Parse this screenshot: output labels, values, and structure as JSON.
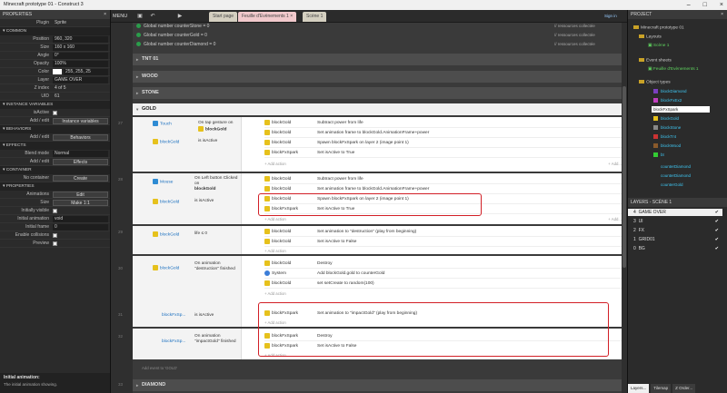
{
  "window": {
    "title": "Minecraft prototype 01 - Construct 3"
  },
  "toolbar": {
    "menu": "MENU",
    "sign_in": "Sign in"
  },
  "tabs": [
    {
      "label": "Start page",
      "active": false
    },
    {
      "label": "Feuille d'Evènements 1",
      "active": true
    },
    {
      "label": "Scène 1",
      "active": false
    }
  ],
  "properties": {
    "title": "PROPERTIES",
    "plugin_label": "Plugin",
    "plugin_value": "Sprite",
    "sections": {
      "common": "COMMON",
      "instance_vars": "INSTANCE VARIABLES",
      "behaviors": "BEHAVIORS",
      "effects": "EFFECTS",
      "container": "CONTAINER",
      "props": "PROPERTIES"
    },
    "rows": {
      "position": {
        "label": "Position",
        "value": "960, 320"
      },
      "size": {
        "label": "Size",
        "value": "160 x 160"
      },
      "angle": {
        "label": "Angle",
        "value": "0°"
      },
      "opacity": {
        "label": "Opacity",
        "value": "100%"
      },
      "color": {
        "label": "Color",
        "value": "255, 255, 25"
      },
      "layer": {
        "label": "Layer",
        "value": "GAME OVER"
      },
      "zindex": {
        "label": "Z index",
        "value": "4 of 5"
      },
      "uid": {
        "label": "UID",
        "value": "61"
      },
      "isactive": {
        "label": "isActive"
      },
      "addedit_iv": {
        "label": "Add / edit",
        "btn": "Instance variables"
      },
      "addedit_beh": {
        "label": "Add / edit",
        "btn": "Behaviors"
      },
      "blend": {
        "label": "Blend mode",
        "value": "Normal"
      },
      "addedit_fx": {
        "label": "Add / edit",
        "btn": "Effects"
      },
      "nocontainer": {
        "label": "No container",
        "btn": "Create"
      },
      "animations": {
        "label": "Animations",
        "btn": "Edit"
      },
      "sizebtn": {
        "label": "Size",
        "btn": "Make 1:1"
      },
      "initvis": {
        "label": "Initially visible"
      },
      "initanim": {
        "label": "Initial animation",
        "value": "void"
      },
      "initframe": {
        "label": "Initial frame",
        "value": "0"
      },
      "enablecol": {
        "label": "Enable collisions"
      },
      "preview": {
        "label": "Preview"
      }
    },
    "footer_title": "Initial animation:",
    "footer_desc": "The initial animation showing."
  },
  "globals": [
    {
      "text": "Global number counterStone = 0",
      "comment": "// ressources collectée"
    },
    {
      "text": "Global number counterGold = 0",
      "comment": "// ressources collectée"
    },
    {
      "text": "Global number counterDiamond = 0",
      "comment": "// ressources collectée"
    }
  ],
  "groups": {
    "tnt": "TNT 01",
    "wood": "WOOD",
    "stone": "STONE",
    "gold": "GOLD",
    "diamond": "DIAMOND"
  },
  "events": {
    "e1": {
      "num": "27",
      "c1_obj": "Touch",
      "c1_text": "On tap gesture on",
      "c1_target": "blockGold",
      "c2_obj": "blockGold",
      "c2_text": "is isActive",
      "actions": [
        {
          "obj": "blockGold",
          "text": "Subtract power from life"
        },
        {
          "obj": "blockGold",
          "text": "Set animation frame to blockGold.AnimationFrame+power"
        },
        {
          "obj": "blockGold",
          "text": "Spawn blockFxSpark on layer 2 (image point 1)"
        },
        {
          "obj": "blockFxSpark",
          "text": "Set isActive to True"
        }
      ]
    },
    "e2": {
      "num": "28",
      "c1_obj": "Mouse",
      "c1_text": "On Left button Clicked on",
      "c1_target": "blockGold",
      "c2_obj": "blockGold",
      "c2_text": "is isActive",
      "actions": [
        {
          "obj": "blockGold",
          "text": "Subtract power from life"
        },
        {
          "obj": "blockGold",
          "text": "Set animation frame to blockGold.AnimationFrame+power"
        },
        {
          "obj": "blockGold",
          "text": "Spawn blockFxSpark on layer 2 (image point 1)"
        },
        {
          "obj": "blockFxSpark",
          "text": "Set isActive to True"
        }
      ]
    },
    "e3": {
      "num": "29",
      "c1_obj": "blockGold",
      "c1_text": "life ≤ 0",
      "actions": [
        {
          "obj": "blockGold",
          "text": "Set animation to \"destruction\" (play from beginning)"
        },
        {
          "obj": "blockGold",
          "text": "Set isActive to False"
        }
      ]
    },
    "e4": {
      "num": "30",
      "c1_obj": "blockGold",
      "c1_text": "On animation \"destruction\" finished",
      "actions": [
        {
          "obj": "blockGold",
          "text": "Destroy"
        },
        {
          "obj": "System",
          "text": "Add blockGold.gold to counterGold"
        },
        {
          "obj": "blockGold",
          "text": "set setCreate to random(100)"
        }
      ]
    },
    "e5": {
      "num": "31",
      "c1_obj": "blockFxSp...",
      "c1_text": "is isActive",
      "actions": [
        {
          "obj": "blockFxSpark",
          "text": "Set animation to \"impactGold\" (play from beginning)"
        }
      ]
    },
    "e6": {
      "num": "32",
      "c1_obj": "blockFxSp...",
      "c1_text": "On animation \"impactGold\" finished",
      "actions": [
        {
          "obj": "blockFxSpark",
          "text": "Destroy"
        },
        {
          "obj": "blockFxSpark",
          "text": "Set isActive to False"
        }
      ]
    },
    "add_action": "+ Add action",
    "add_more": "+ Add...",
    "add_event": "Add event to 'GOLD'",
    "diamond_num": "33"
  },
  "project": {
    "title": "PROJECT",
    "root": "Minecraft prototype 01",
    "layouts": "Layouts",
    "scene": "Scène 1",
    "eventsheets": "Event sheets",
    "sheet": "Feuille d'Evènements 1",
    "objecttypes": "Object types",
    "objects": [
      "blockDiamond",
      "blockFxEx2",
      "blockFxSpark",
      "blockGold",
      "blockStone",
      "blockTnt",
      "blockWood",
      "bt",
      "counterDiamond",
      "counterDiamond",
      "counterGold"
    ],
    "selected_object": "blockFxSpark"
  },
  "layers": {
    "title": "LAYERS - SCÈNE 1",
    "rows": [
      {
        "num": "4",
        "name": "GAME OVER"
      },
      {
        "num": "3",
        "name": "UI"
      },
      {
        "num": "2",
        "name": "FX"
      },
      {
        "num": "1",
        "name": "GRID01"
      },
      {
        "num": "0",
        "name": "BG"
      }
    ]
  },
  "right_tabs": [
    "Layers...",
    "Tilemap",
    "Z Order..."
  ]
}
